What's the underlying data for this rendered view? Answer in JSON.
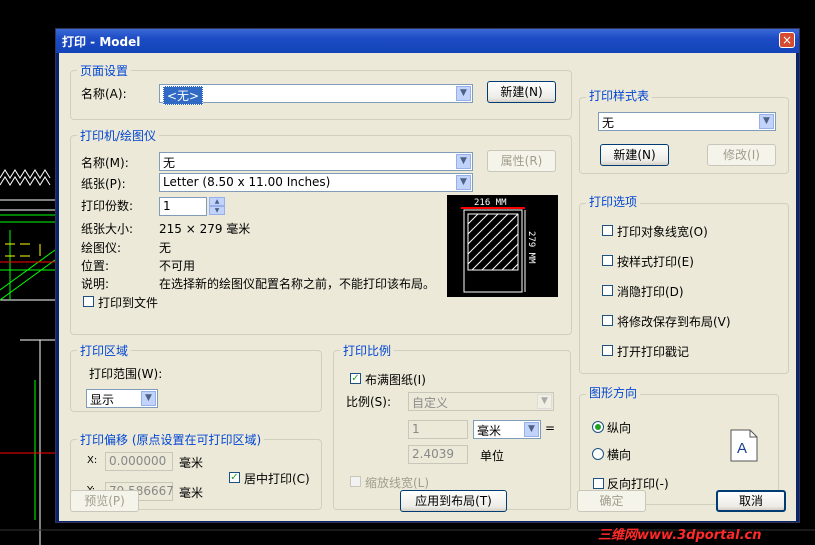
{
  "window": {
    "title": "打印 - Model",
    "close_glyph": "×"
  },
  "page_setup": {
    "title": "页面设置",
    "name_label": "名称(A):",
    "name_value": "<无>",
    "new_button": "新建(N)"
  },
  "printer": {
    "title": "打印机/绘图仪",
    "name_label": "名称(M):",
    "name_value": "无",
    "properties_button": "属性(R)",
    "paper_label": "纸张(P):",
    "paper_value": "Letter (8.50 x 11.00 Inches)",
    "copies_label": "打印份数:",
    "copies_value": "1",
    "paper_size_label": "纸张大小:",
    "paper_size_value": "215 × 279  毫米",
    "plotter_label": "绘图仪:",
    "plotter_value": "无",
    "location_label": "位置:",
    "location_value": "不可用",
    "description_label": "说明:",
    "description_value": "在选择新的绘图仪配置名称之前，不能打印该布局。",
    "print_to_file": "打印到文件",
    "preview_width": "216 MM",
    "preview_height": "279 MM"
  },
  "plot_area": {
    "title": "打印区域",
    "range_label": "打印范围(W):",
    "range_value": "显示"
  },
  "plot_offset": {
    "title": "打印偏移 (原点设置在可打印区域)",
    "x_label": "X:",
    "x_value": "0.000000",
    "x_unit": "毫米",
    "y_label": "Y:",
    "y_value": "79.586667",
    "y_unit": "毫米",
    "center_label": "居中打印(C)",
    "center_checked": true
  },
  "plot_scale": {
    "title": "打印比例",
    "fit_label": "布满图纸(I)",
    "fit_checked": true,
    "scale_label": "比例(S):",
    "scale_value": "自定义",
    "value1": "1",
    "unit_value": "毫米",
    "equals": "=",
    "value2": "2.4039",
    "unit_label": "单位",
    "lineweights_label": "缩放线宽(L)"
  },
  "plot_style": {
    "title": "打印样式表",
    "value": "无",
    "new_button": "新建(N)",
    "edit_button": "修改(I)"
  },
  "plot_options": {
    "title": "打印选项",
    "items": [
      "打印对象线宽(O)",
      "按样式打印(E)",
      "消隐打印(D)",
      "将修改保存到布局(V)",
      "打开打印戳记"
    ]
  },
  "orientation": {
    "title": "图形方向",
    "portrait": "纵向",
    "landscape": "横向",
    "reverse": "反向打印(-)",
    "icon_letter": "A"
  },
  "footer": {
    "preview": "预览(P)",
    "apply": "应用到布局(T)",
    "ok": "确定",
    "cancel": "取消"
  },
  "watermark": "三维网www.3dportal.cn"
}
